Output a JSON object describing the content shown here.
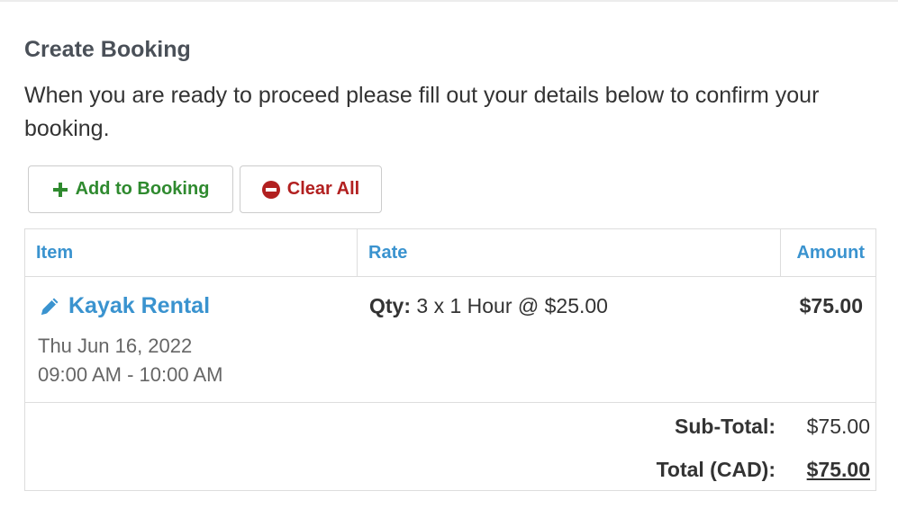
{
  "page": {
    "title": "Create Booking",
    "intro": "When you are ready to proceed please fill out your details below to confirm your booking."
  },
  "actions": {
    "add_label": "Add to Booking",
    "clear_label": "Clear All"
  },
  "table": {
    "headers": {
      "item": "Item",
      "rate": "Rate",
      "amount": "Amount"
    },
    "rows": [
      {
        "name": "Kayak Rental",
        "date": "Thu Jun 16, 2022",
        "time": "09:00 AM - 10:00 AM",
        "qty_label": "Qty:",
        "qty_value": "3 x 1 Hour @ $25.00",
        "amount": "$75.00"
      }
    ],
    "subtotal_label": "Sub-Total:",
    "subtotal_value": "$75.00",
    "total_label": "Total (CAD):",
    "total_value": "$75.00"
  },
  "colors": {
    "link": "#3a93cf",
    "add": "#2f8a2f",
    "clear": "#b22020"
  },
  "icons": {
    "add": "plus-icon",
    "clear": "minus-circle-icon",
    "edit": "pencil-icon"
  }
}
